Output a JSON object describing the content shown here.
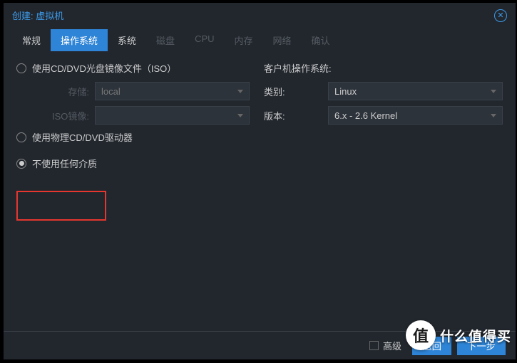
{
  "title": "创建: 虚拟机",
  "tabs": {
    "general": "常规",
    "os": "操作系统",
    "system": "系统",
    "disk": "磁盘",
    "cpu": "CPU",
    "memory": "内存",
    "network": "网络",
    "confirm": "确认"
  },
  "media": {
    "useIso": "使用CD/DVD光盘镜像文件（ISO）",
    "storageLabel": "存储:",
    "storageValue": "local",
    "isoLabel": "ISO镜像:",
    "isoValue": "",
    "usePhysical": "使用物理CD/DVD驱动器",
    "useNone": "不使用任何介质"
  },
  "guest": {
    "header": "客户机操作系统:",
    "typeLabel": "类别:",
    "typeValue": "Linux",
    "versionLabel": "版本:",
    "versionValue": "6.x - 2.6 Kernel"
  },
  "footer": {
    "advanced": "高级",
    "back": "返回",
    "next": "下一步"
  },
  "watermark": {
    "badge": "值",
    "text": "什么值得买"
  }
}
